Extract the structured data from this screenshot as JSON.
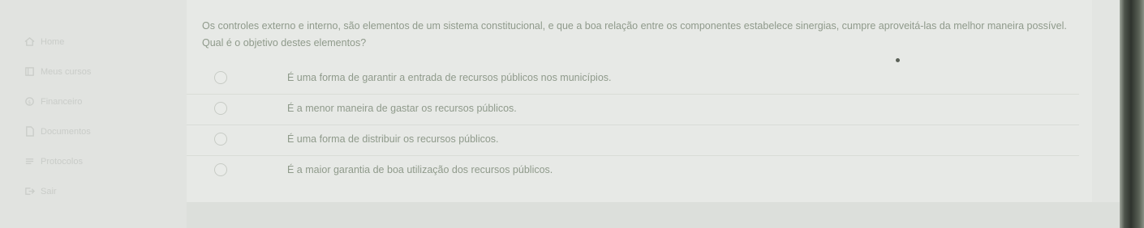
{
  "sidebar": {
    "items": [
      {
        "label": "Home",
        "icon": "home-icon"
      },
      {
        "label": "Meus cursos",
        "icon": "book-icon"
      },
      {
        "label": "Financeiro",
        "icon": "money-icon"
      },
      {
        "label": "Documentos",
        "icon": "document-icon"
      },
      {
        "label": "Protocolos",
        "icon": "protocol-icon"
      },
      {
        "label": "Sair",
        "icon": "logout-icon"
      }
    ]
  },
  "question": {
    "text": "Os controles externo e interno, são elementos de um sistema constitucional, e que a boa relação entre os componentes estabelece sinergias, cumpre aproveitá-las da melhor maneira possível. Qual é o objetivo destes elementos?"
  },
  "options": [
    {
      "label": "É uma forma de garantir a entrada de recursos públicos nos municípios."
    },
    {
      "label": "É a menor maneira de gastar os recursos públicos."
    },
    {
      "label": "É uma forma de distribuir os recursos públicos."
    },
    {
      "label": "É a maior garantia de boa utilização dos recursos públicos."
    }
  ]
}
